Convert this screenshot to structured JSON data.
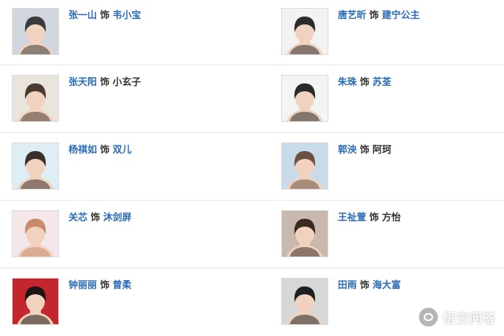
{
  "separator": "饰",
  "cast": [
    {
      "actor": "张一山",
      "role": "韦小宝",
      "actor_link": true,
      "role_link": true,
      "photo_bg": "#cfd6dd",
      "photo_fg": "#3a3a3a"
    },
    {
      "actor": "唐艺昕",
      "role": "建宁公主",
      "actor_link": true,
      "role_link": true,
      "photo_bg": "#f2f2f2",
      "photo_fg": "#2b2b2b"
    },
    {
      "actor": "张天阳",
      "role": "小玄子",
      "actor_link": true,
      "role_link": false,
      "photo_bg": "#e9e4dc",
      "photo_fg": "#4a3a30"
    },
    {
      "actor": "朱珠",
      "role": "苏荃",
      "actor_link": true,
      "role_link": true,
      "photo_bg": "#f4f4f4",
      "photo_fg": "#2a2a2a"
    },
    {
      "actor": "杨祺如",
      "role": "双儿",
      "actor_link": true,
      "role_link": true,
      "photo_bg": "#dfeef4",
      "photo_fg": "#3a2e28"
    },
    {
      "actor": "郭泱",
      "role": "阿珂",
      "actor_link": true,
      "role_link": false,
      "photo_bg": "#c9dbe8",
      "photo_fg": "#6b5240"
    },
    {
      "actor": "关芯",
      "role": "沐剑屏",
      "actor_link": true,
      "role_link": true,
      "photo_bg": "#f3e7ea",
      "photo_fg": "#c98a6a"
    },
    {
      "actor": "王祉萱",
      "role": "方怡",
      "actor_link": true,
      "role_link": false,
      "photo_bg": "#c8b8ad",
      "photo_fg": "#3a2a22"
    },
    {
      "actor": "钟丽丽",
      "role": "曾柔",
      "actor_link": true,
      "role_link": true,
      "photo_bg": "#c3262d",
      "photo_fg": "#1e1412"
    },
    {
      "actor": "田雨",
      "role": "海大富",
      "actor_link": true,
      "role_link": true,
      "photo_bg": "#d7d7d7",
      "photo_fg": "#1f1f1f"
    }
  ],
  "watermark": {
    "text": "悟空问答",
    "icon": "wukong-logo-icon"
  }
}
